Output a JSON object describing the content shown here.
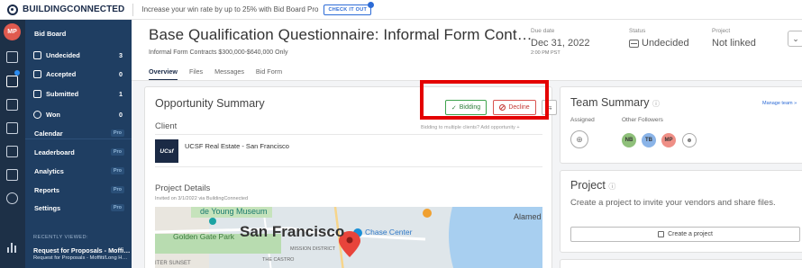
{
  "topbar": {
    "brand_name": "BUILDINGCONNECTED",
    "promo_text": "Increase your win rate by up to 25% with Bid Board Pro",
    "cta_label": "CHECK IT OUT"
  },
  "rail": {
    "avatar_initials": "MP"
  },
  "nav": {
    "items": [
      {
        "label": "Bid Board",
        "count": ""
      },
      {
        "label": "Undecided",
        "count": "3"
      },
      {
        "label": "Accepted",
        "count": "0"
      },
      {
        "label": "Submitted",
        "count": "1"
      },
      {
        "label": "Won",
        "count": "0"
      },
      {
        "label": "Calendar",
        "badge": "Pro"
      },
      {
        "label": "Leaderboard",
        "badge": "Pro"
      },
      {
        "label": "Analytics",
        "badge": "Pro"
      },
      {
        "label": "Reports",
        "badge": "Pro"
      },
      {
        "label": "Settings",
        "badge": "Pro"
      }
    ],
    "recent_heading": "RECENTLY VIEWED:",
    "recent_title": "Request for Proposals - Moffi…",
    "recent_sub": "Request for Proposals - Moffitt/Long H…"
  },
  "header": {
    "title": "Base Qualification Questionnaire: Informal Form Cont…",
    "subtitle": "Informal Form Contracts $300,000-$640,000 Only",
    "tabs": [
      "Overview",
      "Files",
      "Messages",
      "Bid Form"
    ],
    "due_label": "Due date",
    "due_value": "Dec 31, 2022",
    "due_time": "2:00 PM PST",
    "status_label": "Status",
    "status_value": "Undecided",
    "project_label": "Project",
    "project_value": "Not linked"
  },
  "summary": {
    "title": "Opportunity Summary",
    "bidding_label": "Bidding",
    "decline_label": "Decline",
    "client_label": "Client",
    "bid_link": "Bidding to multiple clients? Add opportunity +",
    "client_logo": "UCsf",
    "client_name": "UCSF Real Estate - San Francisco",
    "details_label": "Project Details",
    "invited_text": "Invited on 3/1/2022 via BuildingConnected",
    "map_labels": {
      "museum": "de Young Museum",
      "city": "San Francisco",
      "park": "Golden Gate Park",
      "chase": "Chase Center",
      "alameda": "Alamed",
      "castro": "THE CASTRO",
      "mission": "MISSION DISTRICT",
      "sunset": "ITER SUNSET"
    }
  },
  "team": {
    "title": "Team Summary",
    "manage_link": "Manage team »",
    "assigned_label": "Assigned",
    "followers_label": "Other Followers",
    "followers": [
      {
        "initials": "NB",
        "color": "#8fc07a"
      },
      {
        "initials": "TB",
        "color": "#8ab4e8"
      },
      {
        "initials": "MP",
        "color": "#ef8f86"
      }
    ]
  },
  "project": {
    "title": "Project",
    "description": "Create a project to invite your vendors and share files.",
    "create_label": "Create a project"
  }
}
